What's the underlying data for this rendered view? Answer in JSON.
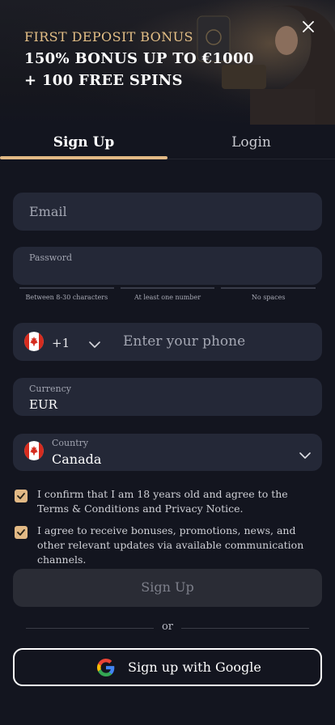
{
  "banner": {
    "kicker": "FIRST DEPOSIT BONUS",
    "line1": "150% BONUS UP TO €1000",
    "line2": "+ 100 FREE SPINS",
    "close_icon": "close-icon"
  },
  "tabs": [
    {
      "label": "Sign Up",
      "active": true
    },
    {
      "label": "Login",
      "active": false
    }
  ],
  "form": {
    "email": {
      "placeholder": "Email"
    },
    "password": {
      "label": "Password",
      "hints": [
        "Between 8-30 characters",
        "At least one number",
        "No spaces"
      ]
    },
    "phone": {
      "code": "+1",
      "placeholder": "Enter your phone",
      "flag_icon": "canada-flag-icon"
    },
    "currency": {
      "label": "Currency",
      "value": "EUR"
    },
    "country": {
      "label": "Country",
      "value": "Canada",
      "flag_icon": "canada-flag-icon"
    },
    "checkboxes": [
      {
        "text": "I confirm that I am 18 years old and agree to the Terms & Conditions and Privacy Notice.",
        "checked": true
      },
      {
        "text": "I agree to receive bonuses, promotions, news, and other relevant updates via available communication channels.",
        "checked": true
      }
    ],
    "signup_button": "Sign Up",
    "or_text": "or",
    "google_button": "Sign up with Google"
  },
  "colors": {
    "background": "#13151f",
    "field": "#242837",
    "accent": "#e2b985"
  }
}
